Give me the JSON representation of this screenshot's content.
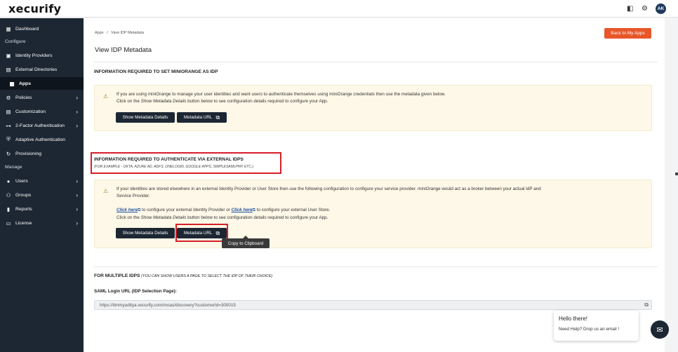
{
  "app": {
    "logo": "xecurify",
    "avatar_initials": "AK"
  },
  "sidebar": {
    "items": [
      {
        "label": "Dashboard",
        "icon": "grid-icon",
        "glyph": "▦",
        "chev": ""
      },
      {
        "label": "Identity Providers",
        "icon": "id-card-icon",
        "glyph": "▣",
        "chev": ""
      },
      {
        "label": "External Directories",
        "icon": "directory-icon",
        "glyph": "▤",
        "chev": ""
      },
      {
        "label": "Apps",
        "icon": "apps-icon",
        "glyph": "▦",
        "chev": ""
      },
      {
        "label": "Policies",
        "icon": "policy-icon",
        "glyph": "⚙",
        "chev": "›"
      },
      {
        "label": "Customization",
        "icon": "customization-icon",
        "glyph": "▤",
        "chev": "›"
      },
      {
        "label": "2-Factor Authentication",
        "icon": "key-icon",
        "glyph": "⊶",
        "chev": "›"
      },
      {
        "label": "Adaptive Authentication",
        "icon": "shield-icon",
        "glyph": "⛨",
        "chev": ""
      },
      {
        "label": "Provisioning",
        "icon": "sync-icon",
        "glyph": "↻",
        "chev": ""
      },
      {
        "label": "Users",
        "icon": "user-icon",
        "glyph": "●",
        "chev": "›"
      },
      {
        "label": "Groups",
        "icon": "group-icon",
        "glyph": "⚇",
        "chev": "›"
      },
      {
        "label": "Reports",
        "icon": "report-icon",
        "glyph": "▮",
        "chev": "›"
      },
      {
        "label": "License",
        "icon": "license-icon",
        "glyph": "▭",
        "chev": "›"
      }
    ],
    "sections": {
      "configure": "Configure",
      "manage": "Manage"
    }
  },
  "breadcrumb": {
    "root": "Apps",
    "sep": "/",
    "current": "View IDP Metadata"
  },
  "header": {
    "title": "View IDP Metadata",
    "back_button": "Back to My Apps"
  },
  "section1": {
    "heading": "INFORMATION REQUIRED TO SET MINIORANGE AS IDP",
    "line1": "If you are using miniOrange to manage your user identities and want users to authenticate themselves using miniOrange credentials then use the metadata given below.",
    "line2_pre": "Click on the ",
    "line2_em": "Show Metadata Details",
    "line2_post": " button below to see configuration details required to configure your App.",
    "btn_details": "Show Metadata Details",
    "btn_url": "Metadata URL"
  },
  "section2": {
    "heading": "INFORMATION REQUIRED TO AUTHENTICATE VIA EXTERNAL IDPS",
    "subheading": "(FOR EXAMPLE - OKTA, AZURE AD, ADFS, ONELOGIN, GOOGLE APPS, SIMPLESAMLPHP, ETC.)",
    "line1": "If your identities are stored elsewhere in an external Identity Provider or User Store then use the following configuration to configure your service provider. miniOrange would act as a broker between your actual IdP and",
    "line1b": "Service Provider.",
    "link1": "Click here",
    "mid1": " to configure your external Identity Provider or ",
    "link2": "Click here",
    "mid2": " to configure your external User Store.",
    "line3_pre": "Click on the ",
    "line3_em": "Show Metadata Details",
    "line3_post": " button below to see configuration details required to configure your App.",
    "btn_details": "Show Metadata Details",
    "btn_url": "Metadata URL",
    "tooltip": "Copy to Clipboard"
  },
  "section3": {
    "heading": "FOR MULTIPLE IDPS",
    "heading_note": "(YOU CAN SHOW USERS A PAGE TO SELECT THE IDP OF THEIR CHOICE)",
    "label": "SAML Login URL (IDP Selection Page):",
    "url": "https://timmyaditya.xecurify.com/moas/discovery?customerId=300015"
  },
  "chat": {
    "title": "Hello there!",
    "message": "Need Help? Drop us an email !"
  },
  "colors": {
    "sidebar": "#1c2733",
    "accent": "#e8562a",
    "highlight": "#d42028",
    "note_bg": "#fdf8e7"
  }
}
